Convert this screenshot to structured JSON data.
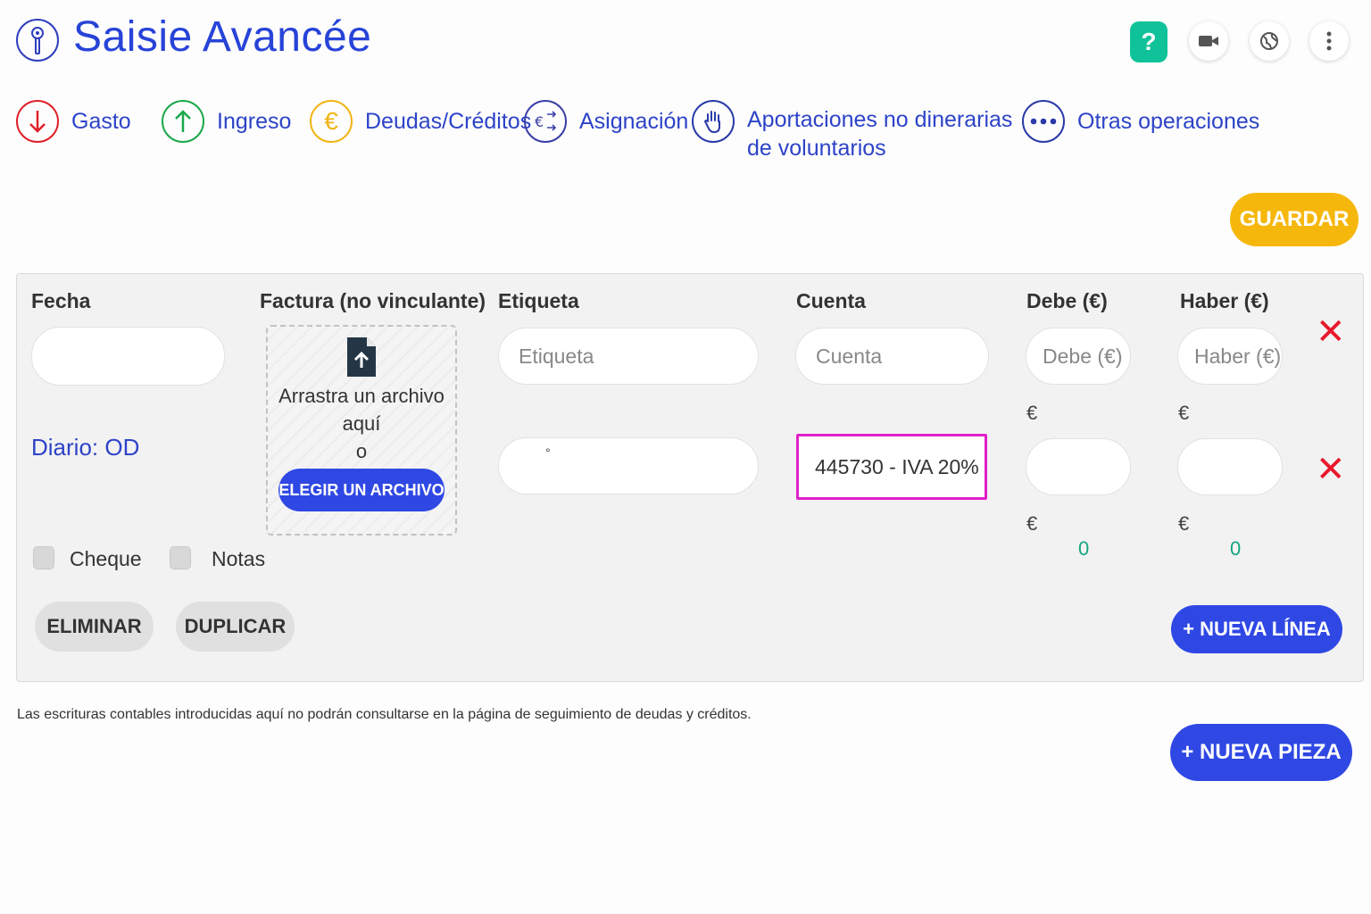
{
  "header": {
    "title": "Saisie Avancée",
    "help_label": "?",
    "logo_icon": "key-icon",
    "actions": [
      "help-icon",
      "video-camera-icon",
      "globe-icon",
      "more-vertical-icon"
    ]
  },
  "operation_types": [
    {
      "label": "Gasto",
      "icon": "arrow-down-icon",
      "color": "#e0202a"
    },
    {
      "label": "Ingreso",
      "icon": "arrow-up-icon",
      "color": "#1aa84a"
    },
    {
      "label": "Deudas/Créditos",
      "icon": "euro-icon",
      "color": "#f2b413"
    },
    {
      "label": "Asignación",
      "icon": "euro-exchange-icon",
      "color": "#3a3fa8"
    },
    {
      "label_line1": "Aportaciones no dinerarias",
      "label_line2": "de voluntarios",
      "icon": "hand-icon",
      "color": "#2a3aa8"
    },
    {
      "label": "Otras operaciones",
      "icon": "more-dots-icon",
      "color": "#2a3aa8"
    }
  ],
  "actions": {
    "save": "GUARDAR",
    "delete": "ELIMINAR",
    "duplicate": "DUPLICAR",
    "new_line": "+ NUEVA LÍNEA",
    "new_piece": "+ NUEVA PIEZA"
  },
  "columns": {
    "fecha": "Fecha",
    "factura": "Factura (no vinculante)",
    "etiqueta": "Etiqueta",
    "cuenta": "Cuenta",
    "debe": "Debe (€)",
    "haber": "Haber (€)"
  },
  "row1": {
    "fecha_value": "",
    "etiqueta_placeholder": "Etiqueta",
    "cuenta_placeholder": "Cuenta",
    "debe_placeholder": "Debe (€)",
    "haber_placeholder": "Haber (€)",
    "currency": "€"
  },
  "row2": {
    "etiqueta_value": "°",
    "cuenta_value": "445730 - IVA 20%",
    "currency": "€",
    "debe_total": "0",
    "haber_total": "0"
  },
  "dropzone": {
    "line1": "Arrastra un archivo",
    "line2": "aquí",
    "or": "o",
    "button": "ELEGIR UN ARCHIVO"
  },
  "journal": "Diario: OD",
  "options": {
    "cheque": "Cheque",
    "notas": "Notas"
  },
  "footer_note": "Las escrituras contables introducidas aquí no podrán consultarse en la página de  seguimiento de  deudas y créditos.",
  "colors": {
    "primary": "#2f48e4",
    "title": "#2743d8",
    "save": "#f6b70d",
    "help": "#10c29a",
    "delete_icon": "#e8192c",
    "highlight": "#e020c8",
    "zero_value": "#13a57d"
  }
}
